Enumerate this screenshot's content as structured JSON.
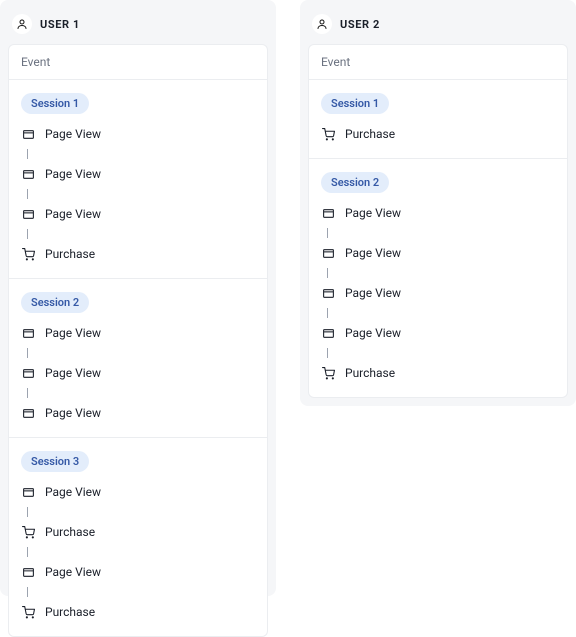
{
  "columns": [
    {
      "title": "USER 1",
      "event_header": "Event",
      "sessions": [
        {
          "label": "Session 1",
          "events": [
            {
              "type": "pageview",
              "label": "Page View"
            },
            {
              "type": "pageview",
              "label": "Page View"
            },
            {
              "type": "pageview",
              "label": "Page View"
            },
            {
              "type": "purchase",
              "label": "Purchase"
            }
          ]
        },
        {
          "label": "Session 2",
          "events": [
            {
              "type": "pageview",
              "label": "Page View"
            },
            {
              "type": "pageview",
              "label": "Page View"
            },
            {
              "type": "pageview",
              "label": "Page View"
            }
          ]
        },
        {
          "label": "Session 3",
          "events": [
            {
              "type": "pageview",
              "label": "Page View"
            },
            {
              "type": "purchase",
              "label": "Purchase"
            },
            {
              "type": "pageview",
              "label": "Page View"
            },
            {
              "type": "purchase",
              "label": "Purchase"
            }
          ]
        }
      ]
    },
    {
      "title": "USER 2",
      "event_header": "Event",
      "sessions": [
        {
          "label": "Session 1",
          "events": [
            {
              "type": "purchase",
              "label": "Purchase"
            }
          ]
        },
        {
          "label": "Session 2",
          "events": [
            {
              "type": "pageview",
              "label": "Page View"
            },
            {
              "type": "pageview",
              "label": "Page View"
            },
            {
              "type": "pageview",
              "label": "Page View"
            },
            {
              "type": "pageview",
              "label": "Page View"
            },
            {
              "type": "purchase",
              "label": "Purchase"
            }
          ]
        }
      ]
    }
  ]
}
